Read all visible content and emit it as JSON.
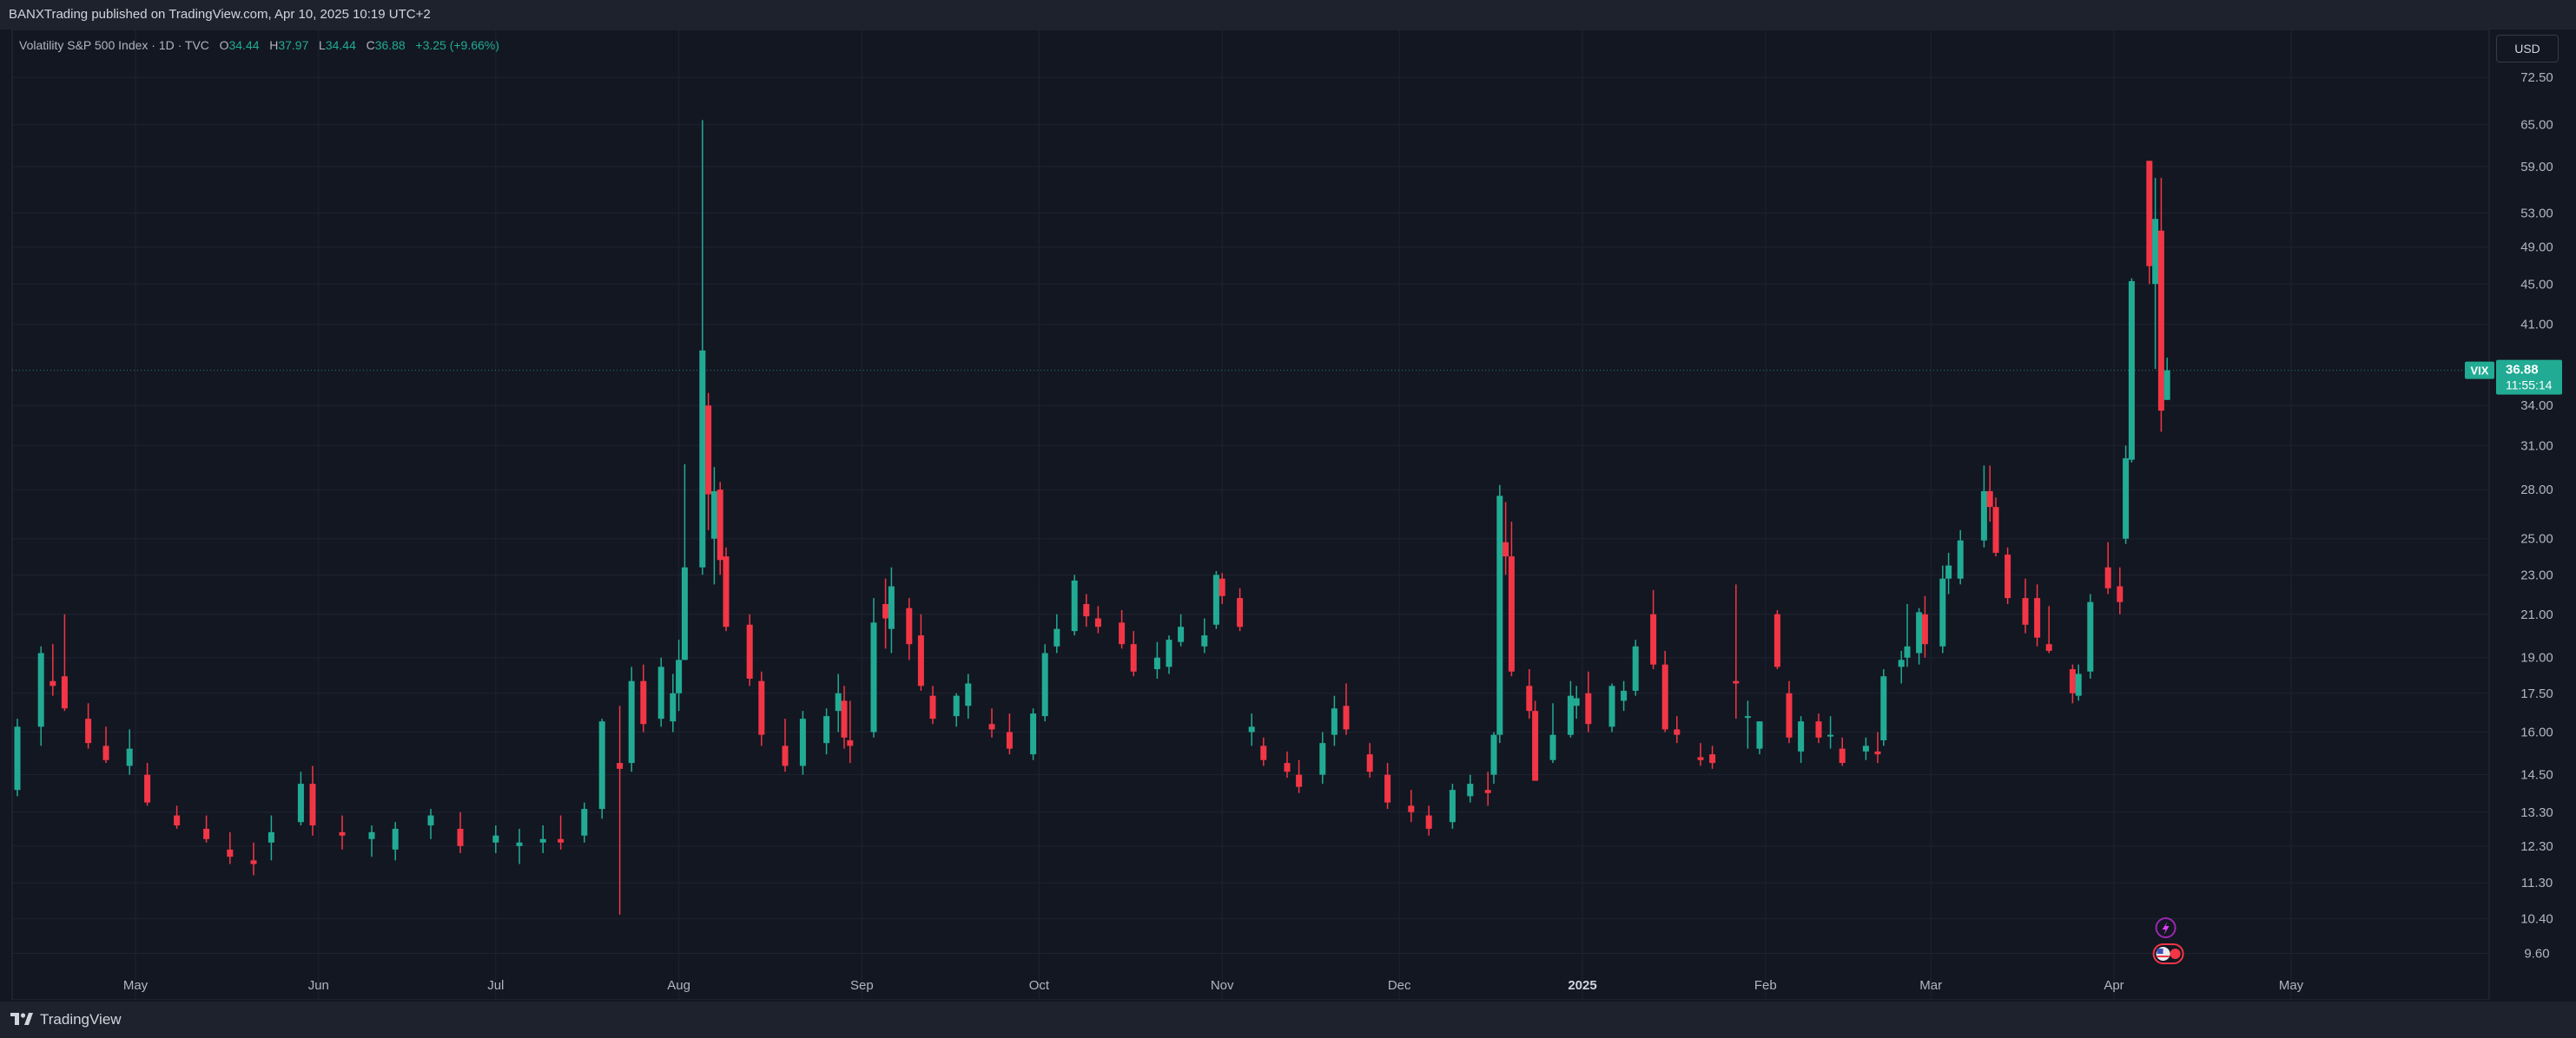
{
  "header": {
    "published": "BANXTrading published on TradingView.com, Apr 10, 2025 10:19 UTC+2"
  },
  "legend": {
    "symbol": "Volatility S&P 500 Index · 1D · TVC",
    "o_label": "O",
    "o_value": "34.44",
    "h_label": "H",
    "h_value": "37.97",
    "l_label": "L",
    "l_value": "34.44",
    "c_label": "C",
    "c_value": "36.88",
    "change": "+3.25 (+9.66%)"
  },
  "currency": "USD",
  "price_tag": {
    "symbol": "VIX",
    "price": "36.88",
    "countdown": "11:55:14"
  },
  "footer": {
    "brand": "TradingView"
  },
  "colors": {
    "up": "#22ab94",
    "down": "#f23645",
    "bg": "#131722",
    "grid": "#1f2330",
    "text": "#b2b5be"
  },
  "event_icons": [
    "lightning-icon",
    "us-flag-icon"
  ],
  "chart_data": {
    "type": "candlestick",
    "title": "Volatility S&P 500 Index · 1D · TVC",
    "y_scale": "log",
    "ylim": [
      8.8,
      80
    ],
    "y_ticks": [
      "72.50",
      "65.00",
      "59.00",
      "53.00",
      "49.00",
      "45.00",
      "41.00",
      "34.00",
      "31.00",
      "28.00",
      "25.00",
      "23.00",
      "21.00",
      "19.00",
      "17.50",
      "16.00",
      "14.50",
      "13.30",
      "12.30",
      "11.30",
      "10.40",
      "9.60"
    ],
    "x_ticks": [
      "May",
      "Jun",
      "Jul",
      "Aug",
      "Sep",
      "Oct",
      "Nov",
      "Dec",
      "2025",
      "Feb",
      "Mar",
      "Apr",
      "May"
    ],
    "x_range": [
      "2024-04-11",
      "2025-05-31"
    ],
    "last_price": 36.88,
    "candles": [
      {
        "d": "2024-04-11",
        "o": 14.0,
        "h": 16.5,
        "l": 13.8,
        "c": 16.2
      },
      {
        "d": "2024-04-15",
        "o": 16.2,
        "h": 19.5,
        "l": 15.5,
        "c": 19.2
      },
      {
        "d": "2024-04-17",
        "o": 18.0,
        "h": 19.6,
        "l": 17.4,
        "c": 17.8
      },
      {
        "d": "2024-04-19",
        "o": 18.2,
        "h": 21.0,
        "l": 16.8,
        "c": 16.9
      },
      {
        "d": "2024-04-23",
        "o": 16.5,
        "h": 17.1,
        "l": 15.4,
        "c": 15.6
      },
      {
        "d": "2024-04-26",
        "o": 15.5,
        "h": 16.2,
        "l": 14.9,
        "c": 15.0
      },
      {
        "d": "2024-04-30",
        "o": 14.8,
        "h": 16.1,
        "l": 14.5,
        "c": 15.4
      },
      {
        "d": "2024-05-03",
        "o": 14.5,
        "h": 14.9,
        "l": 13.5,
        "c": 13.6
      },
      {
        "d": "2024-05-08",
        "o": 13.2,
        "h": 13.5,
        "l": 12.8,
        "c": 12.9
      },
      {
        "d": "2024-05-13",
        "o": 12.8,
        "h": 13.2,
        "l": 12.4,
        "c": 12.5
      },
      {
        "d": "2024-05-17",
        "o": 12.2,
        "h": 12.7,
        "l": 11.8,
        "c": 12.0
      },
      {
        "d": "2024-05-21",
        "o": 11.9,
        "h": 12.4,
        "l": 11.5,
        "c": 11.8
      },
      {
        "d": "2024-05-24",
        "o": 12.4,
        "h": 13.2,
        "l": 11.9,
        "c": 12.7
      },
      {
        "d": "2024-05-29",
        "o": 13.0,
        "h": 14.6,
        "l": 12.9,
        "c": 14.2
      },
      {
        "d": "2024-05-31",
        "o": 14.2,
        "h": 14.8,
        "l": 12.6,
        "c": 12.9
      },
      {
        "d": "2024-06-05",
        "o": 12.7,
        "h": 13.2,
        "l": 12.2,
        "c": 12.6
      },
      {
        "d": "2024-06-10",
        "o": 12.5,
        "h": 12.9,
        "l": 12.0,
        "c": 12.7
      },
      {
        "d": "2024-06-14",
        "o": 12.2,
        "h": 13.0,
        "l": 11.9,
        "c": 12.8
      },
      {
        "d": "2024-06-20",
        "o": 12.9,
        "h": 13.4,
        "l": 12.5,
        "c": 13.2
      },
      {
        "d": "2024-06-25",
        "o": 12.8,
        "h": 13.3,
        "l": 12.1,
        "c": 12.3
      },
      {
        "d": "2024-07-01",
        "o": 12.4,
        "h": 12.9,
        "l": 12.1,
        "c": 12.6
      },
      {
        "d": "2024-07-05",
        "o": 12.3,
        "h": 12.8,
        "l": 11.8,
        "c": 12.4
      },
      {
        "d": "2024-07-09",
        "o": 12.4,
        "h": 12.9,
        "l": 12.1,
        "c": 12.5
      },
      {
        "d": "2024-07-12",
        "o": 12.5,
        "h": 13.2,
        "l": 12.2,
        "c": 12.4
      },
      {
        "d": "2024-07-16",
        "o": 12.6,
        "h": 13.6,
        "l": 12.4,
        "c": 13.4
      },
      {
        "d": "2024-07-19",
        "o": 13.4,
        "h": 16.5,
        "l": 13.1,
        "c": 16.4
      },
      {
        "d": "2024-07-22",
        "o": 14.9,
        "h": 17.0,
        "l": 10.5,
        "c": 14.7
      },
      {
        "d": "2024-07-24",
        "o": 14.9,
        "h": 18.6,
        "l": 14.6,
        "c": 18.0
      },
      {
        "d": "2024-07-26",
        "o": 18.0,
        "h": 18.7,
        "l": 16.0,
        "c": 16.3
      },
      {
        "d": "2024-07-29",
        "o": 16.5,
        "h": 19.0,
        "l": 16.2,
        "c": 18.6
      },
      {
        "d": "2024-07-31",
        "o": 16.4,
        "h": 18.3,
        "l": 16.0,
        "c": 17.5
      },
      {
        "d": "2024-08-01",
        "o": 17.5,
        "h": 19.8,
        "l": 16.8,
        "c": 18.9
      },
      {
        "d": "2024-08-02",
        "o": 18.9,
        "h": 29.7,
        "l": 18.9,
        "c": 23.4
      },
      {
        "d": "2024-08-05",
        "o": 23.4,
        "h": 65.7,
        "l": 23.0,
        "c": 38.6
      },
      {
        "d": "2024-08-06",
        "o": 34.0,
        "h": 35.0,
        "l": 25.5,
        "c": 27.7
      },
      {
        "d": "2024-08-07",
        "o": 25.0,
        "h": 29.5,
        "l": 22.5,
        "c": 27.9
      },
      {
        "d": "2024-08-08",
        "o": 28.0,
        "h": 28.5,
        "l": 23.0,
        "c": 23.8
      },
      {
        "d": "2024-08-09",
        "o": 24.0,
        "h": 24.5,
        "l": 20.2,
        "c": 20.4
      },
      {
        "d": "2024-08-13",
        "o": 20.5,
        "h": 21.0,
        "l": 17.8,
        "c": 18.1
      },
      {
        "d": "2024-08-15",
        "o": 18.0,
        "h": 18.4,
        "l": 15.5,
        "c": 15.9
      },
      {
        "d": "2024-08-19",
        "o": 15.5,
        "h": 16.5,
        "l": 14.6,
        "c": 14.8
      },
      {
        "d": "2024-08-22",
        "o": 14.8,
        "h": 16.8,
        "l": 14.5,
        "c": 16.5
      },
      {
        "d": "2024-08-26",
        "o": 15.6,
        "h": 16.9,
        "l": 15.2,
        "c": 16.6
      },
      {
        "d": "2024-08-28",
        "o": 16.8,
        "h": 18.3,
        "l": 16.0,
        "c": 17.5
      },
      {
        "d": "2024-08-29",
        "o": 17.2,
        "h": 17.8,
        "l": 15.4,
        "c": 15.8
      },
      {
        "d": "2024-08-30",
        "o": 15.7,
        "h": 17.2,
        "l": 14.9,
        "c": 15.5
      },
      {
        "d": "2024-09-03",
        "o": 16.0,
        "h": 21.8,
        "l": 15.8,
        "c": 20.6
      },
      {
        "d": "2024-09-05",
        "o": 21.5,
        "h": 22.8,
        "l": 19.4,
        "c": 20.8
      },
      {
        "d": "2024-09-06",
        "o": 20.3,
        "h": 23.4,
        "l": 19.2,
        "c": 22.4
      },
      {
        "d": "2024-09-09",
        "o": 21.3,
        "h": 21.8,
        "l": 18.9,
        "c": 19.6
      },
      {
        "d": "2024-09-11",
        "o": 20.0,
        "h": 21.0,
        "l": 17.6,
        "c": 17.8
      },
      {
        "d": "2024-09-13",
        "o": 17.4,
        "h": 17.8,
        "l": 16.3,
        "c": 16.5
      },
      {
        "d": "2024-09-17",
        "o": 16.6,
        "h": 17.5,
        "l": 16.2,
        "c": 17.4
      },
      {
        "d": "2024-09-19",
        "o": 17.0,
        "h": 18.3,
        "l": 16.5,
        "c": 17.9
      },
      {
        "d": "2024-09-23",
        "o": 16.3,
        "h": 16.9,
        "l": 15.8,
        "c": 16.1
      },
      {
        "d": "2024-09-26",
        "o": 16.0,
        "h": 16.7,
        "l": 15.2,
        "c": 15.4
      },
      {
        "d": "2024-09-30",
        "o": 15.2,
        "h": 16.9,
        "l": 15.0,
        "c": 16.7
      },
      {
        "d": "2024-10-02",
        "o": 16.6,
        "h": 19.6,
        "l": 16.4,
        "c": 19.2
      },
      {
        "d": "2024-10-04",
        "o": 19.5,
        "h": 21.0,
        "l": 19.2,
        "c": 20.3
      },
      {
        "d": "2024-10-07",
        "o": 20.2,
        "h": 23.0,
        "l": 20.0,
        "c": 22.7
      },
      {
        "d": "2024-10-09",
        "o": 21.5,
        "h": 22.0,
        "l": 20.4,
        "c": 20.9
      },
      {
        "d": "2024-10-11",
        "o": 20.8,
        "h": 21.4,
        "l": 20.1,
        "c": 20.4
      },
      {
        "d": "2024-10-15",
        "o": 20.6,
        "h": 21.2,
        "l": 19.4,
        "c": 19.6
      },
      {
        "d": "2024-10-17",
        "o": 19.6,
        "h": 20.2,
        "l": 18.2,
        "c": 18.4
      },
      {
        "d": "2024-10-21",
        "o": 18.5,
        "h": 19.7,
        "l": 18.1,
        "c": 19.0
      },
      {
        "d": "2024-10-23",
        "o": 18.6,
        "h": 20.0,
        "l": 18.3,
        "c": 19.8
      },
      {
        "d": "2024-10-25",
        "o": 19.7,
        "h": 21.0,
        "l": 19.5,
        "c": 20.4
      },
      {
        "d": "2024-10-29",
        "o": 19.5,
        "h": 20.8,
        "l": 19.2,
        "c": 20.0
      },
      {
        "d": "2024-10-31",
        "o": 20.5,
        "h": 23.2,
        "l": 20.3,
        "c": 23.0
      },
      {
        "d": "2024-11-01",
        "o": 22.8,
        "h": 23.1,
        "l": 21.5,
        "c": 21.9
      },
      {
        "d": "2024-11-04",
        "o": 21.8,
        "h": 22.3,
        "l": 20.2,
        "c": 20.4
      },
      {
        "d": "2024-11-06",
        "o": 16.0,
        "h": 16.7,
        "l": 15.5,
        "c": 16.2
      },
      {
        "d": "2024-11-08",
        "o": 15.5,
        "h": 15.8,
        "l": 14.8,
        "c": 15.0
      },
      {
        "d": "2024-11-12",
        "o": 14.9,
        "h": 15.3,
        "l": 14.4,
        "c": 14.6
      },
      {
        "d": "2024-11-14",
        "o": 14.5,
        "h": 15.0,
        "l": 13.9,
        "c": 14.1
      },
      {
        "d": "2024-11-18",
        "o": 14.5,
        "h": 16.0,
        "l": 14.2,
        "c": 15.6
      },
      {
        "d": "2024-11-20",
        "o": 15.9,
        "h": 17.4,
        "l": 15.5,
        "c": 16.9
      },
      {
        "d": "2024-11-22",
        "o": 17.0,
        "h": 17.9,
        "l": 15.9,
        "c": 16.1
      },
      {
        "d": "2024-11-26",
        "o": 15.2,
        "h": 15.6,
        "l": 14.4,
        "c": 14.6
      },
      {
        "d": "2024-11-29",
        "o": 14.5,
        "h": 14.9,
        "l": 13.4,
        "c": 13.6
      },
      {
        "d": "2024-12-03",
        "o": 13.5,
        "h": 14.0,
        "l": 13.0,
        "c": 13.3
      },
      {
        "d": "2024-12-06",
        "o": 13.2,
        "h": 13.5,
        "l": 12.6,
        "c": 12.8
      },
      {
        "d": "2024-12-10",
        "o": 13.0,
        "h": 14.2,
        "l": 12.8,
        "c": 14.0
      },
      {
        "d": "2024-12-13",
        "o": 13.8,
        "h": 14.5,
        "l": 13.6,
        "c": 14.2
      },
      {
        "d": "2024-12-16",
        "o": 14.0,
        "h": 14.6,
        "l": 13.5,
        "c": 13.9
      },
      {
        "d": "2024-12-17",
        "o": 14.5,
        "h": 16.0,
        "l": 14.2,
        "c": 15.9
      },
      {
        "d": "2024-12-18",
        "o": 15.9,
        "h": 28.3,
        "l": 15.6,
        "c": 27.6
      },
      {
        "d": "2024-12-19",
        "o": 24.8,
        "h": 27.2,
        "l": 23.0,
        "c": 24.0
      },
      {
        "d": "2024-12-20",
        "o": 24.0,
        "h": 26.0,
        "l": 18.2,
        "c": 18.4
      },
      {
        "d": "2024-12-23",
        "o": 17.8,
        "h": 18.5,
        "l": 16.5,
        "c": 16.8
      },
      {
        "d": "2024-12-24",
        "o": 16.8,
        "h": 17.2,
        "l": 14.3,
        "c": 14.3
      },
      {
        "d": "2024-12-27",
        "o": 15.0,
        "h": 17.1,
        "l": 14.9,
        "c": 15.9
      },
      {
        "d": "2024-12-30",
        "o": 15.9,
        "h": 18.0,
        "l": 15.8,
        "c": 17.4
      },
      {
        "d": "2024-12-31",
        "o": 17.0,
        "h": 17.8,
        "l": 16.5,
        "c": 17.3
      },
      {
        "d": "2025-01-02",
        "o": 17.5,
        "h": 18.4,
        "l": 16.0,
        "c": 16.3
      },
      {
        "d": "2025-01-06",
        "o": 16.2,
        "h": 17.9,
        "l": 16.0,
        "c": 17.8
      },
      {
        "d": "2025-01-08",
        "o": 17.2,
        "h": 18.0,
        "l": 16.8,
        "c": 17.6
      },
      {
        "d": "2025-01-10",
        "o": 17.6,
        "h": 19.8,
        "l": 17.4,
        "c": 19.5
      },
      {
        "d": "2025-01-13",
        "o": 21.0,
        "h": 22.2,
        "l": 18.5,
        "c": 18.7
      },
      {
        "d": "2025-01-15",
        "o": 18.7,
        "h": 19.3,
        "l": 16.0,
        "c": 16.1
      },
      {
        "d": "2025-01-17",
        "o": 16.1,
        "h": 16.6,
        "l": 15.6,
        "c": 15.9
      },
      {
        "d": "2025-01-21",
        "o": 15.1,
        "h": 15.6,
        "l": 14.8,
        "c": 15.0
      },
      {
        "d": "2025-01-23",
        "o": 15.2,
        "h": 15.5,
        "l": 14.7,
        "c": 14.9
      },
      {
        "d": "2025-01-27",
        "o": 18.0,
        "h": 22.5,
        "l": 16.5,
        "c": 17.9
      },
      {
        "d": "2025-01-29",
        "o": 16.6,
        "h": 17.2,
        "l": 15.4,
        "c": 16.6
      },
      {
        "d": "2025-01-31",
        "o": 15.4,
        "h": 16.4,
        "l": 15.2,
        "c": 16.4
      },
      {
        "d": "2025-02-03",
        "o": 21.0,
        "h": 21.2,
        "l": 18.5,
        "c": 18.6
      },
      {
        "d": "2025-02-05",
        "o": 17.5,
        "h": 18.0,
        "l": 15.6,
        "c": 15.8
      },
      {
        "d": "2025-02-07",
        "o": 15.3,
        "h": 16.6,
        "l": 14.9,
        "c": 16.4
      },
      {
        "d": "2025-02-10",
        "o": 16.4,
        "h": 16.7,
        "l": 15.6,
        "c": 15.8
      },
      {
        "d": "2025-02-12",
        "o": 15.9,
        "h": 16.6,
        "l": 15.4,
        "c": 15.9
      },
      {
        "d": "2025-02-14",
        "o": 15.4,
        "h": 15.8,
        "l": 14.8,
        "c": 14.9
      },
      {
        "d": "2025-02-18",
        "o": 15.3,
        "h": 15.8,
        "l": 15.0,
        "c": 15.5
      },
      {
        "d": "2025-02-20",
        "o": 15.3,
        "h": 16.0,
        "l": 14.9,
        "c": 15.2
      },
      {
        "d": "2025-02-21",
        "o": 15.7,
        "h": 18.5,
        "l": 15.5,
        "c": 18.2
      },
      {
        "d": "2025-02-24",
        "o": 18.6,
        "h": 19.3,
        "l": 17.9,
        "c": 18.9
      },
      {
        "d": "2025-02-25",
        "o": 19.0,
        "h": 21.5,
        "l": 18.6,
        "c": 19.5
      },
      {
        "d": "2025-02-27",
        "o": 19.2,
        "h": 21.3,
        "l": 18.7,
        "c": 21.1
      },
      {
        "d": "2025-02-28",
        "o": 21.0,
        "h": 21.9,
        "l": 19.0,
        "c": 19.6
      },
      {
        "d": "2025-03-03",
        "o": 19.5,
        "h": 23.5,
        "l": 19.2,
        "c": 22.8
      },
      {
        "d": "2025-03-04",
        "o": 22.8,
        "h": 24.2,
        "l": 22.0,
        "c": 23.5
      },
      {
        "d": "2025-03-06",
        "o": 22.8,
        "h": 25.5,
        "l": 22.5,
        "c": 24.9
      },
      {
        "d": "2025-03-10",
        "o": 24.9,
        "h": 29.6,
        "l": 24.5,
        "c": 27.9
      },
      {
        "d": "2025-03-11",
        "o": 27.9,
        "h": 29.6,
        "l": 26.0,
        "c": 26.9
      },
      {
        "d": "2025-03-12",
        "o": 26.9,
        "h": 27.5,
        "l": 24.0,
        "c": 24.2
      },
      {
        "d": "2025-03-14",
        "o": 24.1,
        "h": 24.5,
        "l": 21.5,
        "c": 21.8
      },
      {
        "d": "2025-03-17",
        "o": 21.8,
        "h": 22.8,
        "l": 20.1,
        "c": 20.5
      },
      {
        "d": "2025-03-19",
        "o": 21.8,
        "h": 22.5,
        "l": 19.5,
        "c": 19.9
      },
      {
        "d": "2025-03-21",
        "o": 19.6,
        "h": 21.4,
        "l": 19.2,
        "c": 19.3
      },
      {
        "d": "2025-03-25",
        "o": 18.5,
        "h": 18.7,
        "l": 17.1,
        "c": 17.5
      },
      {
        "d": "2025-03-26",
        "o": 17.4,
        "h": 18.7,
        "l": 17.2,
        "c": 18.3
      },
      {
        "d": "2025-03-28",
        "o": 18.4,
        "h": 22.0,
        "l": 18.1,
        "c": 21.6
      },
      {
        "d": "2025-03-31",
        "o": 23.4,
        "h": 24.8,
        "l": 22.0,
        "c": 22.3
      },
      {
        "d": "2025-04-02",
        "o": 22.4,
        "h": 23.4,
        "l": 21.0,
        "c": 21.6
      },
      {
        "d": "2025-04-03",
        "o": 25.0,
        "h": 31.0,
        "l": 24.7,
        "c": 30.1
      },
      {
        "d": "2025-04-04",
        "o": 30.0,
        "h": 45.6,
        "l": 29.8,
        "c": 45.3
      },
      {
        "d": "2025-04-07",
        "o": 59.8,
        "h": 59.8,
        "l": 45.0,
        "c": 46.9
      },
      {
        "d": "2025-04-08",
        "o": 45.0,
        "h": 57.5,
        "l": 37.0,
        "c": 52.3
      },
      {
        "d": "2025-04-09",
        "o": 50.9,
        "h": 57.5,
        "l": 32.0,
        "c": 33.6
      },
      {
        "d": "2025-04-10",
        "o": 34.44,
        "h": 37.97,
        "l": 34.44,
        "c": 36.88
      }
    ]
  }
}
